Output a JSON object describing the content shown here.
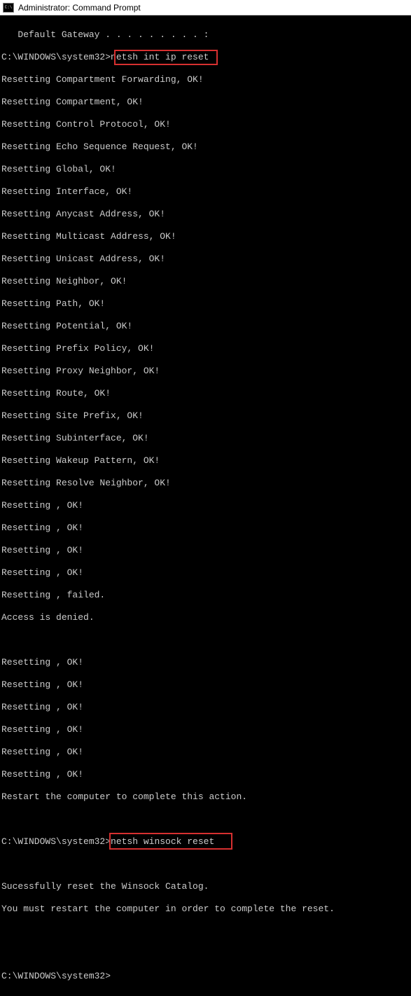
{
  "window": {
    "title": "Administrator: Command Prompt"
  },
  "terminal": {
    "prompt1_path": "C:\\WINDOWS\\system32>",
    "command1": "netsh int ip reset",
    "prompt2_path": "C:\\WINDOWS\\system32>",
    "command2": "netsh winsock reset",
    "prompt3": "C:\\WINDOWS\\system32>",
    "lines": {
      "l0": "   Default Gateway . . . . . . . . . :",
      "l1": "Resetting Compartment Forwarding, OK!",
      "l2": "Resetting Compartment, OK!",
      "l3": "Resetting Control Protocol, OK!",
      "l4": "Resetting Echo Sequence Request, OK!",
      "l5": "Resetting Global, OK!",
      "l6": "Resetting Interface, OK!",
      "l7": "Resetting Anycast Address, OK!",
      "l8": "Resetting Multicast Address, OK!",
      "l9": "Resetting Unicast Address, OK!",
      "l10": "Resetting Neighbor, OK!",
      "l11": "Resetting Path, OK!",
      "l12": "Resetting Potential, OK!",
      "l13": "Resetting Prefix Policy, OK!",
      "l14": "Resetting Proxy Neighbor, OK!",
      "l15": "Resetting Route, OK!",
      "l16": "Resetting Site Prefix, OK!",
      "l17": "Resetting Subinterface, OK!",
      "l18": "Resetting Wakeup Pattern, OK!",
      "l19": "Resetting Resolve Neighbor, OK!",
      "l20": "Resetting , OK!",
      "l21": "Resetting , OK!",
      "l22": "Resetting , OK!",
      "l23": "Resetting , OK!",
      "l24": "Resetting , failed.",
      "l25": "Access is denied.",
      "l26": "",
      "l27": "Resetting , OK!",
      "l28": "Resetting , OK!",
      "l29": "Resetting , OK!",
      "l30": "Resetting , OK!",
      "l31": "Resetting , OK!",
      "l32": "Resetting , OK!",
      "l33": "Restart the computer to complete this action.",
      "l34": "",
      "l35": "",
      "l36": "Sucessfully reset the Winsock Catalog.",
      "l37": "You must restart the computer in order to complete the reset.",
      "l38": ""
    }
  }
}
